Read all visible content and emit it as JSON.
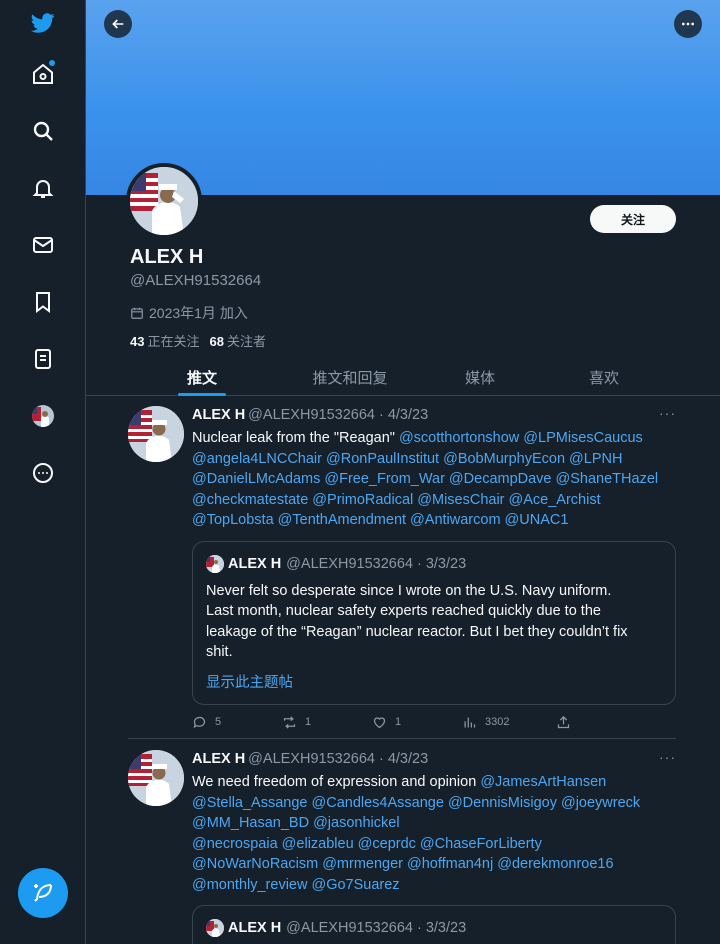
{
  "sidebar": {
    "icons": [
      "twitter-logo",
      "home-icon",
      "search-icon",
      "bell-icon",
      "mail-icon",
      "bookmark-icon",
      "list-icon",
      "profile-avatar",
      "more-icon"
    ],
    "compose_icon": "feather-icon"
  },
  "colors": {
    "accent": "#1d9bf0",
    "background": "#15202b",
    "banner": "#3b92ec",
    "border": "#38444d"
  },
  "profile": {
    "display_name": "ALEX H",
    "handle": "@ALEXH91532664",
    "joined": "2023年1月 加入",
    "following_count": "43",
    "following_label": "正在关注",
    "followers_count": "68",
    "followers_label": "关注者",
    "follow_button": "关注"
  },
  "tabs": [
    {
      "label": "推文",
      "active": true
    },
    {
      "label": "推文和回复",
      "active": false
    },
    {
      "label": "媒体",
      "active": false
    },
    {
      "label": "喜欢",
      "active": false
    }
  ],
  "tweets": [
    {
      "name": "ALEX H",
      "handle_date": "@ALEXH91532664 · 4/3/23",
      "more": "···",
      "text_lines": [
        [
          "Nuclear leak from the \"Reagan\" ",
          "@scotthortonshow @LPMisesCaucus"
        ],
        [
          "",
          "@angela4LNCChair @RonPaulInstitut @BobMurphyEcon @LPNH"
        ],
        [
          "",
          "@DanielLMcAdams @Free_From_War @DecampDave @ShaneTHazel"
        ],
        [
          "",
          "@checkmatestate @PrimoRadical @MisesChair @Ace_Archist"
        ],
        [
          "",
          "@TopLobsta @TenthAmendment @Antiwarcom @UNAC1"
        ]
      ],
      "quote": {
        "name": "ALEX H",
        "handle_date": "@ALEXH91532664 · 3/3/23",
        "text_lines": [
          "Never felt so desperate since I wrote on the U.S. Navy uniform.",
          "Last month, nuclear safety experts reached quickly due to the",
          "leakage of the “Reagan” nuclear reactor. But I bet they couldn’t fix",
          "shit."
        ],
        "show_thread": "显示此主题帖"
      },
      "actions": {
        "replies": "5",
        "retweets": "1",
        "likes": "1",
        "views": "3302"
      }
    },
    {
      "name": "ALEX H",
      "handle_date": "@ALEXH91532664 · 4/3/23",
      "more": "···",
      "text_lines": [
        [
          "We need freedom of expression and opinion ",
          "@JamesArtHansen"
        ],
        [
          "",
          "@Stella_Assange @Candles4Assange @DennisMisigoy @joeywreck"
        ],
        [
          "",
          "@MM_Hasan_BD @jasonhickel"
        ],
        [
          "",
          "@necrospaia @elizableu @ceprdc @ChaseForLiberty"
        ],
        [
          "",
          "@NoWarNoRacism @mrmenger @hoffman4nj @derekmonroe16"
        ],
        [
          "",
          "@monthly_review @Go7Suarez"
        ]
      ],
      "quote": {
        "name": "ALEX H",
        "handle_date": "@ALEXH91532664 · 3/3/23"
      }
    }
  ]
}
